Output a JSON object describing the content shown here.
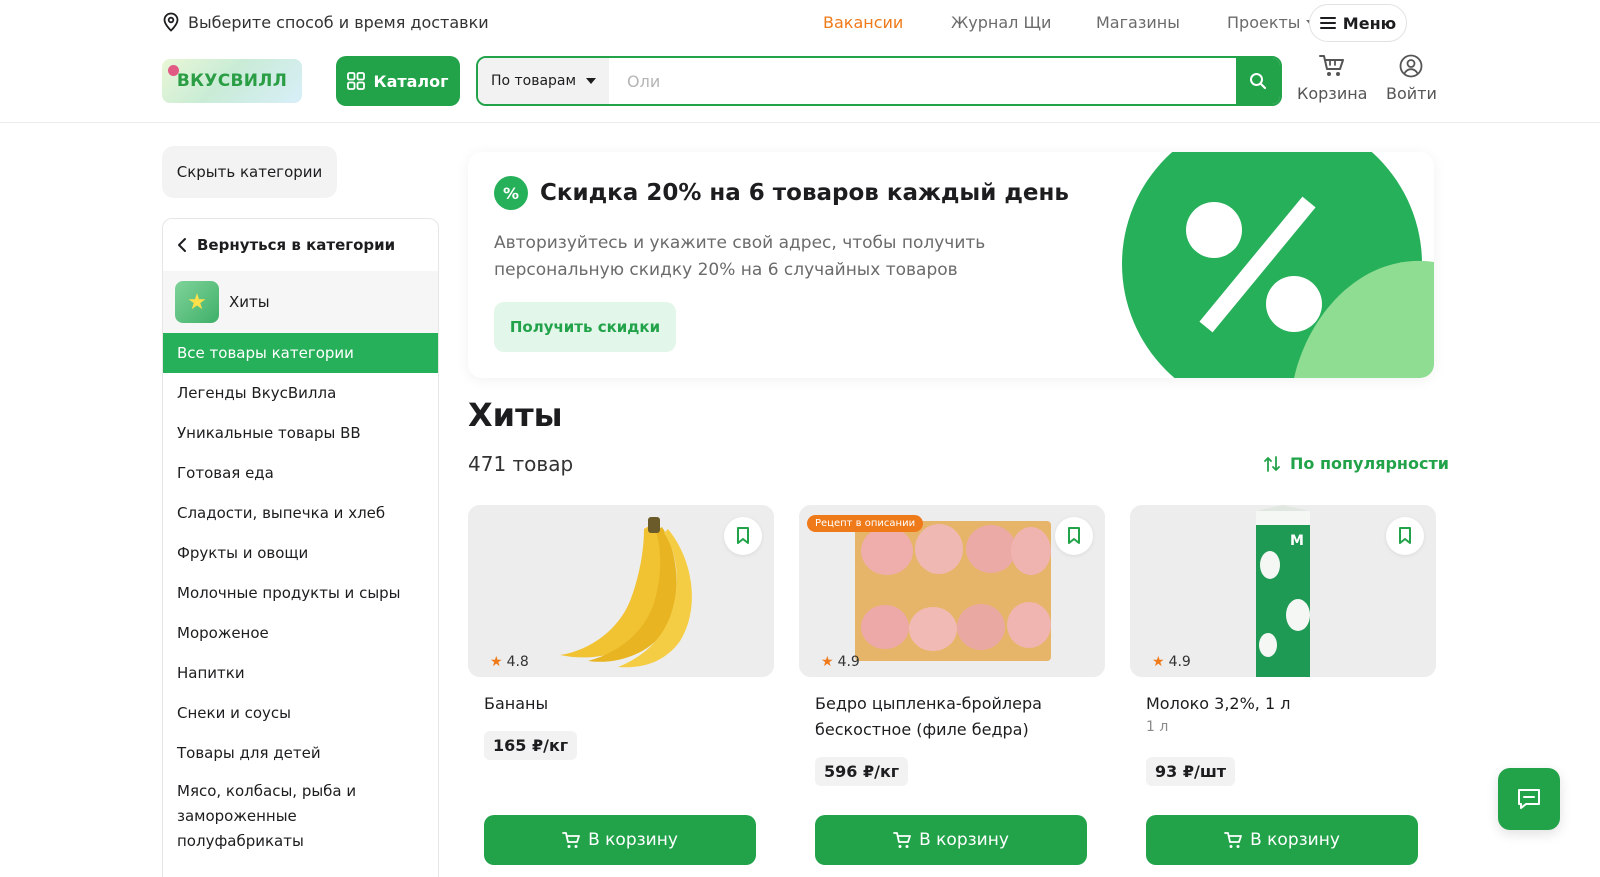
{
  "topbar": {
    "delivery_label": "Выберите способ и время доставки",
    "links": [
      {
        "label": "Вакансии",
        "accent": true
      },
      {
        "label": "Журнал Щи"
      },
      {
        "label": "Магазины"
      },
      {
        "label": "Проекты"
      }
    ],
    "menu_label": "Меню"
  },
  "header": {
    "logo_text": "ВКУСВИЛЛ",
    "catalog_label": "Каталог",
    "search_scope": "По товарам",
    "search_placeholder": "Оли",
    "cart_label": "Корзина",
    "login_label": "Войти"
  },
  "sidebar": {
    "hide_label": "Скрыть категории",
    "back_label": "Вернуться в категории",
    "current_category": "Хиты",
    "items": [
      {
        "label": "Все товары категории",
        "active": true
      },
      {
        "label": "Легенды ВкусВилла"
      },
      {
        "label": "Уникальные товары ВВ"
      },
      {
        "label": "Готовая еда"
      },
      {
        "label": "Сладости, выпечка и хлеб"
      },
      {
        "label": "Фрукты и овощи"
      },
      {
        "label": "Молочные продукты и сыры"
      },
      {
        "label": "Мороженое"
      },
      {
        "label": "Напитки"
      },
      {
        "label": "Снеки и соусы"
      },
      {
        "label": "Товары для детей"
      },
      {
        "label": "Мясо, колбасы, рыба и замороженные полуфабрикаты"
      }
    ]
  },
  "promo": {
    "title": "Скидка 20% на 6 товаров каждый день",
    "text": "Авторизуйтесь и укажите свой адрес, чтобы получить персональную скидку 20% на 6 случайных товаров",
    "button": "Получить скидки"
  },
  "products_section": {
    "title": "Хиты",
    "count": "471 товар",
    "sort_label": "По популярности"
  },
  "products": [
    {
      "name": "Бананы",
      "rating": "4.8",
      "price": "165 ₽/кг",
      "unit": "",
      "badge": "",
      "cart": "В корзину"
    },
    {
      "name": "Бедро цыпленка-бройлера бескостное (филе бедра)",
      "rating": "4.9",
      "price": "596 ₽/кг",
      "unit": "",
      "badge": "Рецепт в описании",
      "cart": "В корзину"
    },
    {
      "name": "Молоко 3,2%, 1 л",
      "rating": "4.9",
      "price": "93 ₽/шт",
      "unit": "1 л",
      "badge": "",
      "cart": "В корзину"
    }
  ],
  "colors": {
    "brand_green": "#22a34a",
    "accent_orange": "#ef7a1a",
    "active_item": "#27b05a"
  },
  "icons": {
    "delivery": "location-pin-icon",
    "menu": "hamburger-icon",
    "catalog": "grid-icon",
    "search": "magnifier-icon",
    "cart": "cart-icon",
    "login": "user-icon",
    "back": "chevron-left-icon",
    "favorite": "bookmark-icon",
    "sort": "sort-arrows-icon",
    "chat": "chat-icon"
  }
}
